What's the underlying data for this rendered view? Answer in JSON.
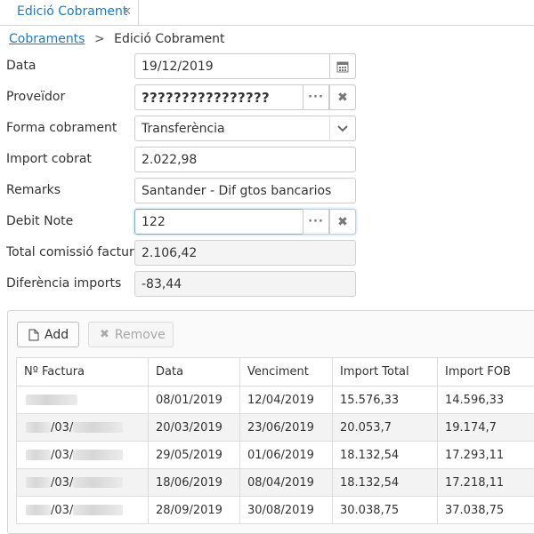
{
  "tab": {
    "label": "Edició Cobrament",
    "close_icon": "close-icon"
  },
  "breadcrumb": {
    "parent": "Cobraments",
    "separator": ">",
    "current": "Edició Cobrament"
  },
  "form": {
    "data": {
      "label": "Data",
      "value": "19/12/2019"
    },
    "proveidor": {
      "label": "Proveïdor",
      "value": "????????????????"
    },
    "forma": {
      "label": "Forma cobrament",
      "value": "Transferència"
    },
    "import": {
      "label": "Import cobrat",
      "value": "2.022,98"
    },
    "remarks": {
      "label": "Remarks",
      "value": "Santander - Dif gtos bancarios"
    },
    "debit": {
      "label": "Debit Note",
      "value": "122"
    },
    "total": {
      "label": "Total comissió factures",
      "value": "2.106,42"
    },
    "diferencia": {
      "label": "Diferència imports",
      "value": "-83,44"
    }
  },
  "toolbar": {
    "add_label": "Add",
    "remove_label": "Remove"
  },
  "table": {
    "columns": [
      "Nº Factura",
      "Data",
      "Venciment",
      "Import Total",
      "Import FOB"
    ],
    "rows": [
      {
        "factura": "",
        "data": "08/01/2019",
        "venciment": "12/04/2019",
        "total": "15.576,33",
        "fob": "14.596,33"
      },
      {
        "factura": "/03/",
        "data": "20/03/2019",
        "venciment": "23/06/2019",
        "total": "20.053,7",
        "fob": "19.174,7"
      },
      {
        "factura": "/03/",
        "data": "29/05/2019",
        "venciment": "01/06/2019",
        "total": "18.132,54",
        "fob": "17.293,11"
      },
      {
        "factura": "/03/",
        "data": "18/06/2019",
        "venciment": "08/04/2019",
        "total": "18.132,54",
        "fob": "17.218,11"
      },
      {
        "factura": "/03/",
        "data": "28/09/2019",
        "venciment": "30/08/2019",
        "total": "30.038,75",
        "fob": "37.038,75"
      }
    ]
  }
}
